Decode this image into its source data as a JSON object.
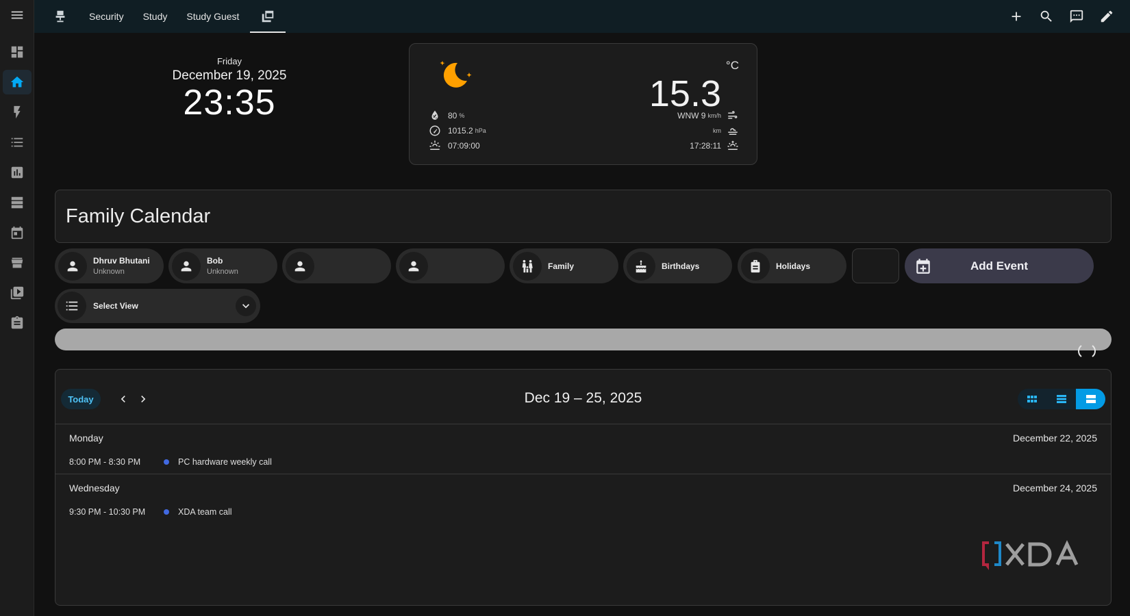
{
  "nav": {
    "tabs": [
      {
        "label": "Security"
      },
      {
        "label": "Study"
      },
      {
        "label": "Study Guest"
      }
    ]
  },
  "clock": {
    "day": "Friday",
    "date": "December 19, 2025",
    "time": "23:35"
  },
  "weather": {
    "unit": "°C",
    "temperature": "15.3",
    "humidity": "80",
    "humidity_unit": "%",
    "pressure": "1015.2",
    "pressure_unit": "hPa",
    "sunrise": "07:09:00",
    "wind": "WNW 9",
    "wind_unit": "km/h",
    "visibility_unit": "km",
    "sunset": "17:28:11"
  },
  "calendar": {
    "title": "Family Calendar",
    "chips": [
      {
        "name": "Dhruv Bhutani",
        "sub": "Unknown",
        "icon": "person-icon"
      },
      {
        "name": "Bob",
        "sub": "Unknown",
        "icon": "person-icon"
      },
      {
        "name": "",
        "sub": "",
        "icon": "person-icon"
      },
      {
        "name": "",
        "sub": "",
        "icon": "person-icon"
      },
      {
        "name": "Family",
        "sub": "",
        "icon": "family-icon"
      },
      {
        "name": "Birthdays",
        "sub": "",
        "icon": "cake-icon"
      },
      {
        "name": "Holidays",
        "sub": "",
        "icon": "bag-icon"
      }
    ],
    "add_event_label": "Add Event",
    "select_view_label": "Select View",
    "today_label": "Today",
    "range": "Dec 19 – 25, 2025",
    "days": [
      {
        "name": "Monday",
        "date": "December 22, 2025",
        "events": [
          {
            "time": "8:00 PM - 8:30 PM",
            "title": "PC hardware weekly call"
          }
        ]
      },
      {
        "name": "Wednesday",
        "date": "December 24, 2025",
        "events": [
          {
            "time": "9:30 PM - 10:30 PM",
            "title": "XDA team call"
          }
        ]
      }
    ]
  },
  "colors": {
    "accent": "#03a9f4",
    "moon": "#ffa000",
    "event_dot": "#4169e1",
    "add_event_bg": "#3b3a4a"
  }
}
